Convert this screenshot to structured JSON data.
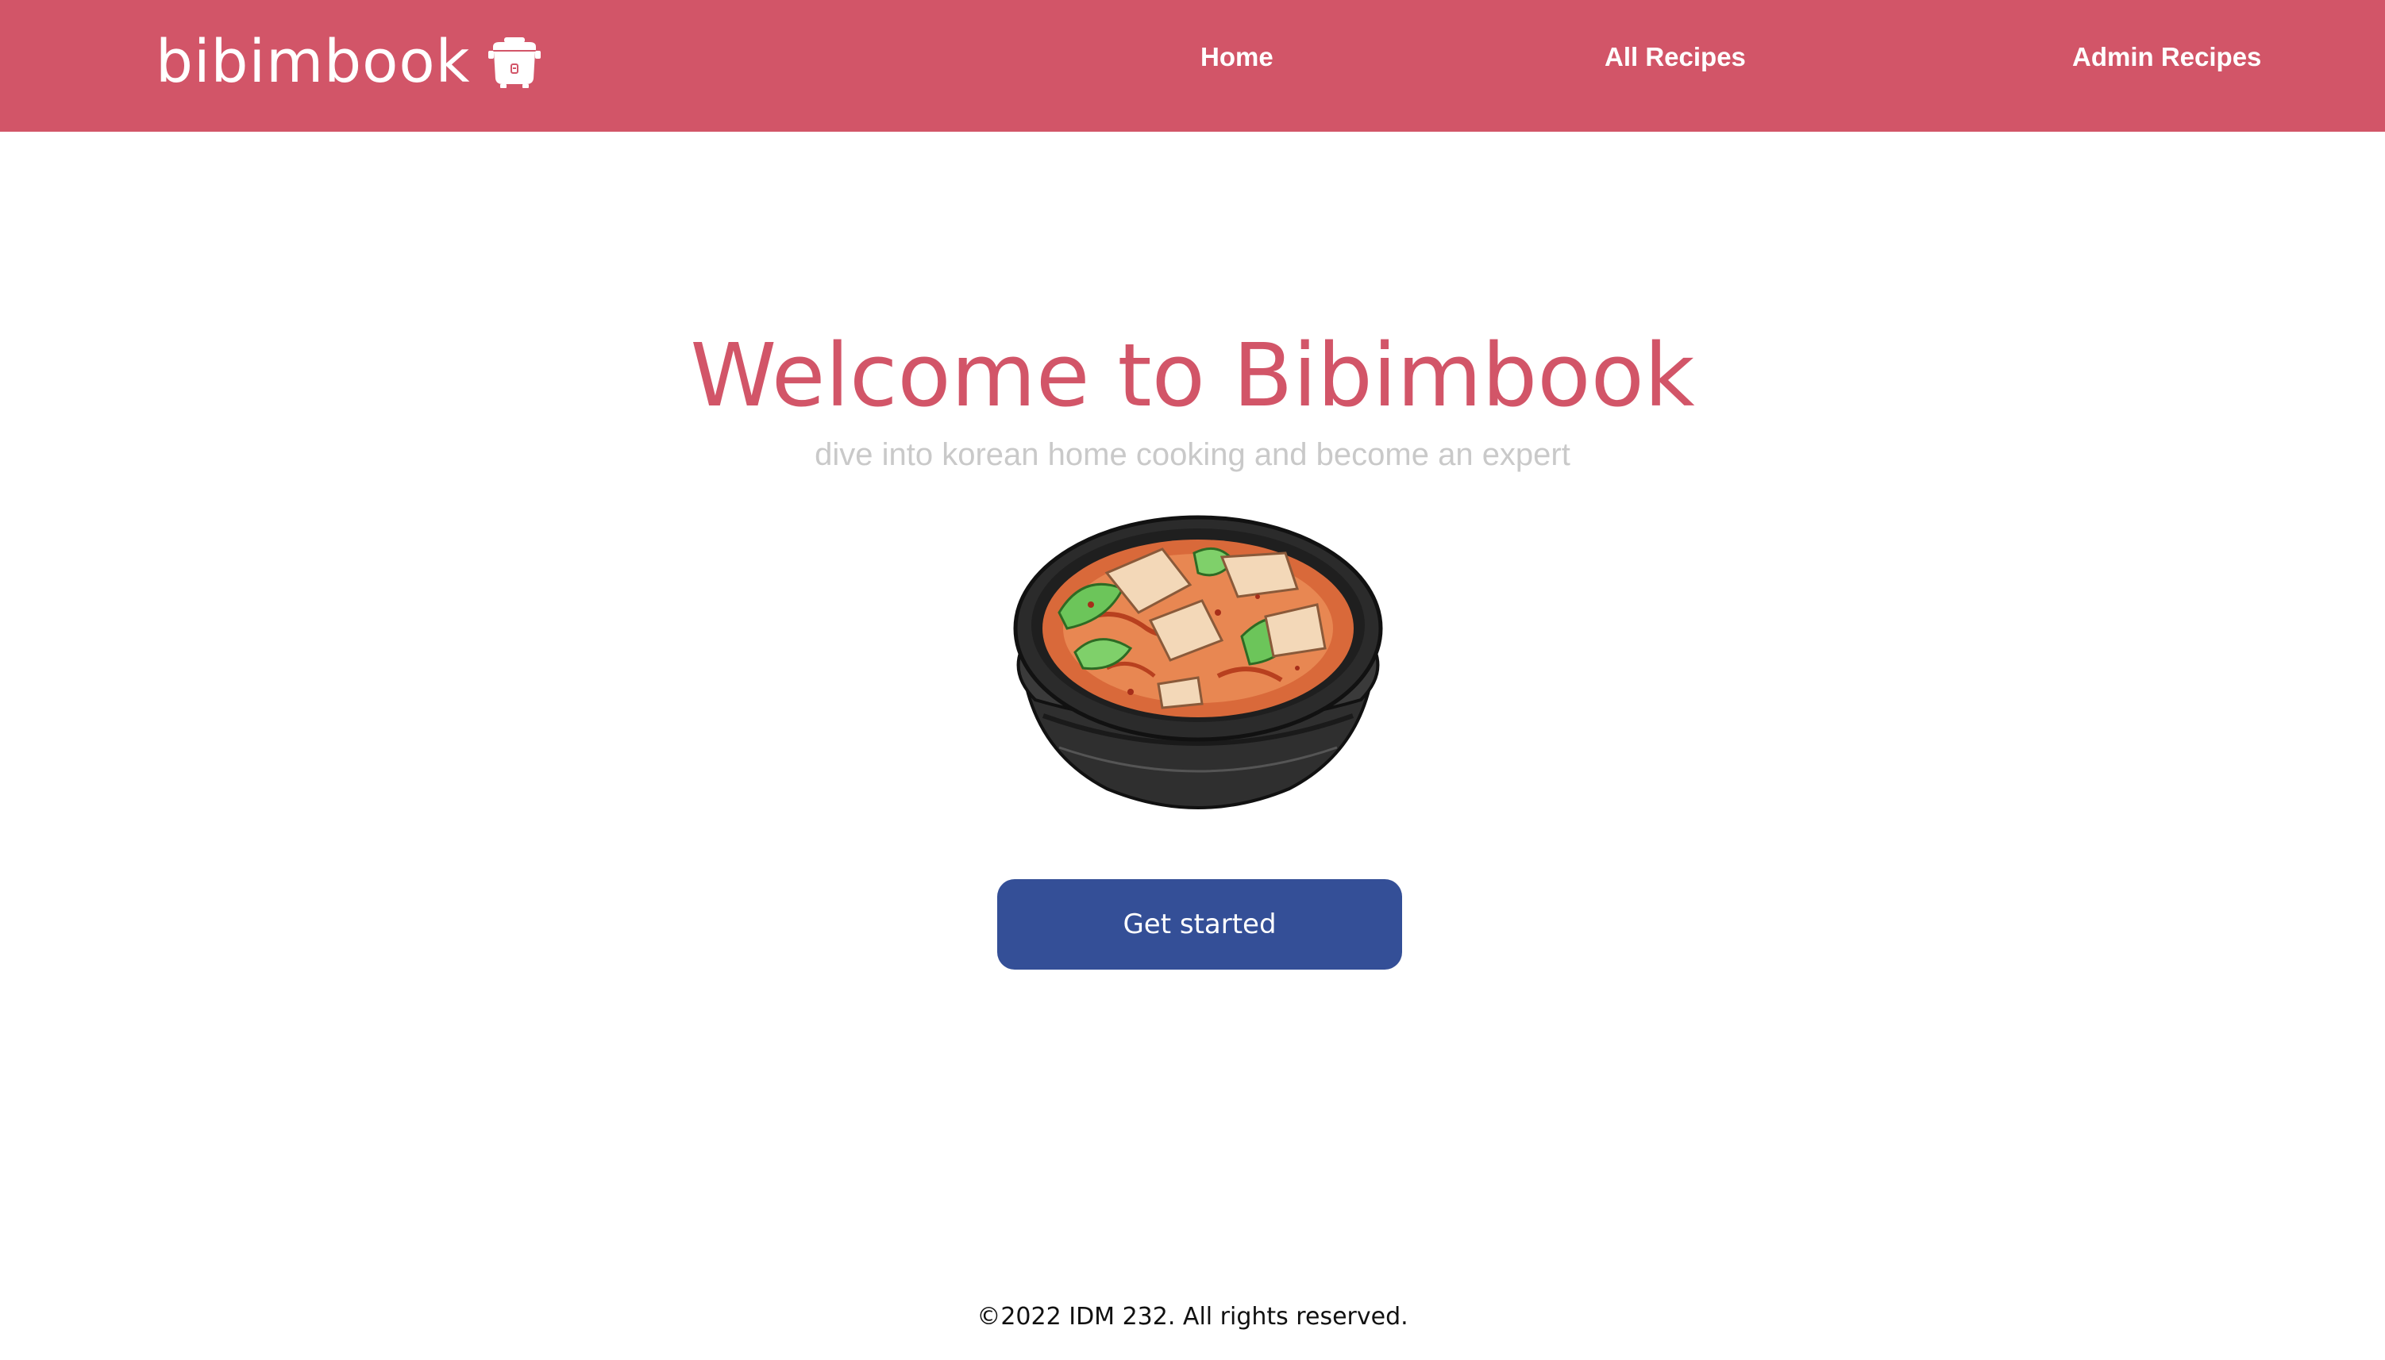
{
  "colors": {
    "brand": "#d25568",
    "header_bg": "#d25568",
    "button_bg": "#344f97",
    "subtitle": "#c9c9c9",
    "footer_text": "#111111"
  },
  "header": {
    "brand_name": "bibimbook",
    "brand_icon": "rice-cooker-icon",
    "nav": [
      {
        "label": "Home"
      },
      {
        "label": "All Recipes"
      },
      {
        "label": "Admin Recipes"
      }
    ]
  },
  "hero": {
    "title": "Welcome to Bibimbook",
    "subtitle": "dive into korean home cooking and become an expert",
    "image": "stew-bowl-illustration",
    "cta_label": "Get started"
  },
  "footer": {
    "text": "©2022 IDM 232. All rights reserved."
  }
}
